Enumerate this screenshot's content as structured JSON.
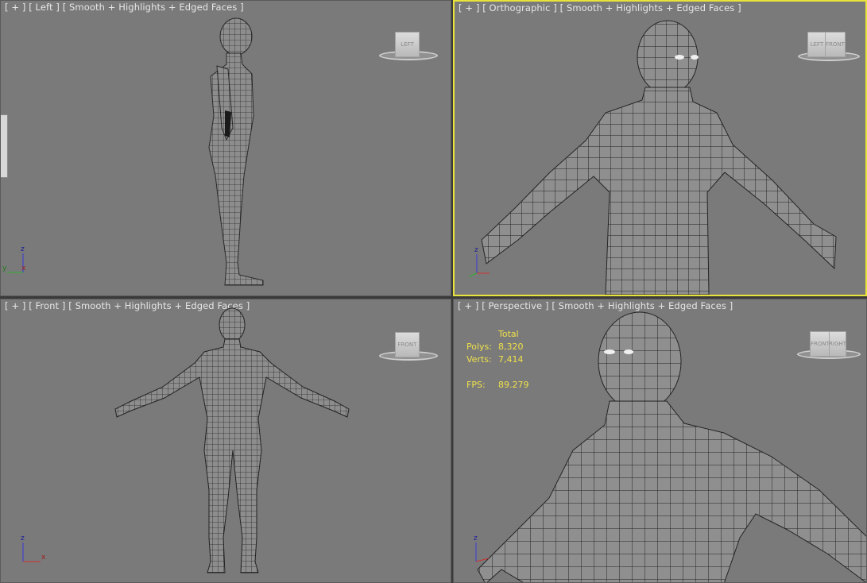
{
  "viewports": {
    "left": {
      "menu": "[ + ]",
      "view": "[ Left ]",
      "shading": "[ Smooth + Highlights + Edged Faces ]",
      "cube": "LEFT"
    },
    "ortho": {
      "menu": "[ + ]",
      "view": "[ Orthographic ]",
      "shading": "[ Smooth + Highlights + Edged Faces ]",
      "cube_a": "LEFT",
      "cube_b": "FRONT"
    },
    "front": {
      "menu": "[ + ]",
      "view": "[ Front ]",
      "shading": "[ Smooth + Highlights + Edged Faces ]",
      "cube": "FRONT"
    },
    "persp": {
      "menu": "[ + ]",
      "view": "[ Perspective ]",
      "shading": "[ Smooth + Highlights + Edged Faces ]",
      "cube_a": "FRONT",
      "cube_b": "RIGHT"
    }
  },
  "stats": {
    "header": "Total",
    "polys_label": "Polys:",
    "polys_value": "8,320",
    "verts_label": "Verts:",
    "verts_value": "7,414",
    "fps_label": "FPS:",
    "fps_value": "89.279"
  },
  "axes": {
    "z": "z",
    "y": "y",
    "x": "x"
  },
  "colors": {
    "viewport_bg": "#7a7a7a",
    "active_border": "#e8e23a",
    "label_text": "#e6e6e6",
    "stats_text": "#f0e14a",
    "axis_x": "#d03030",
    "axis_y": "#30b030",
    "axis_z": "#3a3ad8"
  }
}
